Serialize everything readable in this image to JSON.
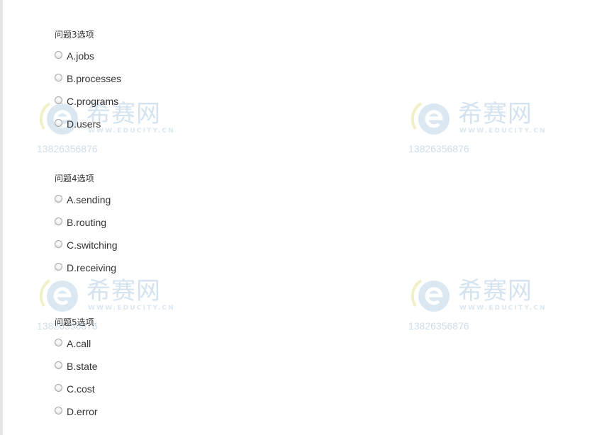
{
  "watermark": {
    "brand": "希赛网",
    "url": "WWW.EDUCITY.CN",
    "phone": "13826356876",
    "logo_icon": "educity-e-logo-icon",
    "color": "#d4e3ef"
  },
  "questions": [
    {
      "title": "问题3选项",
      "options": [
        {
          "label": "A.jobs"
        },
        {
          "label": "B.processes"
        },
        {
          "label": "C.programs"
        },
        {
          "label": "D.users"
        }
      ]
    },
    {
      "title": "问题4选项",
      "options": [
        {
          "label": "A.sending"
        },
        {
          "label": "B.routing"
        },
        {
          "label": "C.switching"
        },
        {
          "label": "D.receiving"
        }
      ]
    },
    {
      "title": "问题5选项",
      "options": [
        {
          "label": "A.call"
        },
        {
          "label": "B.state"
        },
        {
          "label": "C.cost"
        },
        {
          "label": "D.error"
        }
      ]
    }
  ]
}
